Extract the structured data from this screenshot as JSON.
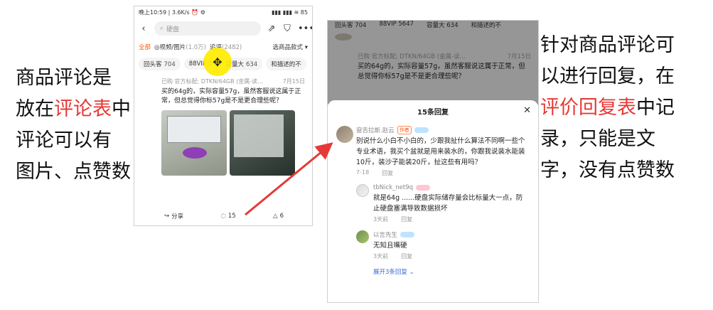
{
  "captions": {
    "left": [
      [
        {
          "t": "商品评论是",
          "red": false
        }
      ],
      [
        {
          "t": "放在",
          "red": false
        },
        {
          "t": "评论表",
          "red": true
        },
        {
          "t": "中",
          "red": false
        }
      ],
      [
        {
          "t": "评论可以有",
          "red": false
        }
      ],
      [
        {
          "t": "图片、点赞数",
          "red": false
        }
      ]
    ],
    "right": [
      [
        {
          "t": "针对商品评论可",
          "red": false
        }
      ],
      [
        {
          "t": "以进行回复，在",
          "red": false
        }
      ],
      [
        {
          "t": "评价回复表",
          "red": true
        },
        {
          "t": "中记",
          "red": false
        }
      ],
      [
        {
          "t": "录，只能是文",
          "red": false
        }
      ],
      [
        {
          "t": "字，没有点赞数",
          "red": false
        }
      ]
    ]
  },
  "left_phone": {
    "status": {
      "time": "晚上10:59 | 3.6K/s",
      "icons": "⏰ ⚙",
      "right": "▮▮▮ ▮▮▮ ≋ 85"
    },
    "search_placeholder": "硬盘",
    "filters": {
      "all": "全部",
      "video": "◎视频/图片",
      "video_count": "(1.0万)",
      "append": "追评",
      "append_count": "(2482)",
      "style": "选商品款式 ▾"
    },
    "tags": [
      {
        "label": "回头客",
        "count": "704"
      },
      {
        "label": "88VIP",
        "count": "5"
      },
      {
        "label": "容量大",
        "count": "634"
      },
      {
        "label": "和描述的不",
        "count": ""
      }
    ],
    "review": {
      "meta": "已购 官方标配; DTKN/64GB (金属-读...",
      "date": "7月15日",
      "text": "买的64g的，实际容量57g，虽然客服说这属于正常，但总觉得你标57g是不是更合理些呢？"
    },
    "actions": {
      "share": "分享",
      "comments": "15",
      "likes": "6"
    }
  },
  "right_phone": {
    "dim_tags": [
      "回头客 704",
      "88VIP 5647",
      "容量大 634",
      "和描述的不"
    ],
    "dim_review": {
      "meta": "已购 官方标配; DTKN/64GB (金属-读...",
      "date": "7月15日",
      "text": "买的64g的，实际容量57g，虽然客服说这属于正常，但总觉得你标57g是不是更合理些呢？"
    },
    "sheet_title": "15条回复",
    "close": "✕",
    "replies": [
      {
        "user": "窗舌拉斯.赵云",
        "badge": "作者",
        "text": "别说什么小白不小白的，少跟我扯什么算法不同啊一些个专业术语，我买个盆就是用来装水的，你跟我说装水能装10斤，装沙子能装20斤，扯这些有用吗？",
        "time": "7-18",
        "reply": "回复"
      },
      {
        "user": "tbNick_net9q",
        "text": "就是64g ......硬盘实际储存量会比标量大一点，防止硬盘塞满导致数据损坏",
        "time": "3天前",
        "reply": "回复"
      },
      {
        "user": "以言先生",
        "text": "无知且嘴硬",
        "time": "3天前",
        "reply": "回复"
      }
    ],
    "more": "展开3条回复 ⌄"
  }
}
